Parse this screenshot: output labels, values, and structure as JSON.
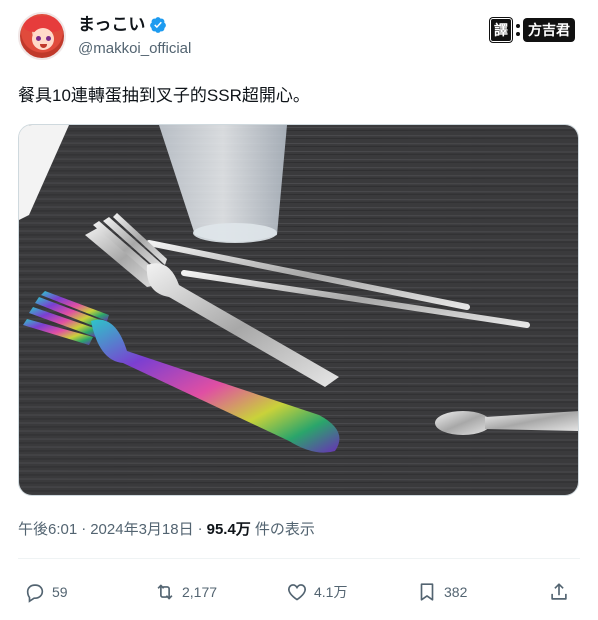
{
  "author": {
    "display_name": "まっこい",
    "handle": "@makkoi_official",
    "verified": true
  },
  "translator_badge": {
    "label": "譯",
    "name": "方吉君"
  },
  "tweet": {
    "text": "餐具10連轉蛋抽到叉子的SSR超開心。"
  },
  "meta": {
    "time": "午後6:01",
    "separator1": "·",
    "date": "2024年3月18日",
    "separator2": "·",
    "views": "95.4万",
    "views_label": "件の表示"
  },
  "actions": {
    "reply_count": "59",
    "retweet_count": "2,177",
    "like_count": "4.1万",
    "bookmark_count": "382"
  },
  "colors": {
    "verified_blue": "#1d9bf0",
    "muted_text": "#536471",
    "table_dark": "#3a3a3c"
  },
  "icons": {
    "verified": "verified-badge-icon",
    "reply": "reply-icon",
    "retweet": "retweet-icon",
    "like": "heart-icon",
    "bookmark": "bookmark-icon",
    "share": "share-icon"
  }
}
